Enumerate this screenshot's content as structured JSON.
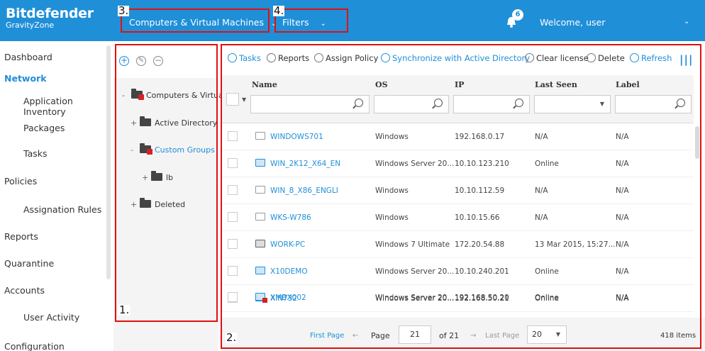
{
  "header": {
    "brand_name": "Bitdefender",
    "brand_sub": "GravityZone",
    "view_menu": "Computers & Virtual Machines",
    "filters_menu": "Filters",
    "notification_count": "6",
    "welcome": "Welcome, user"
  },
  "sidebar": {
    "items": [
      {
        "label": "Dashboard"
      },
      {
        "label": "Network"
      },
      {
        "label": "Application Inventory"
      },
      {
        "label": "Packages"
      },
      {
        "label": "Tasks"
      },
      {
        "label": "Policies"
      },
      {
        "label": "Assignation Rules"
      },
      {
        "label": "Reports"
      },
      {
        "label": "Quarantine"
      },
      {
        "label": "Accounts"
      },
      {
        "label": "User Activity"
      },
      {
        "label": "Configuration"
      }
    ]
  },
  "tree": {
    "nodes": [
      {
        "toggle": "-",
        "label": "Computers & Virtual"
      },
      {
        "toggle": "+",
        "label": "Active Directory"
      },
      {
        "toggle": "-",
        "label": "Custom Groups"
      },
      {
        "toggle": "+",
        "label": "lb"
      },
      {
        "toggle": "+",
        "label": "Deleted"
      }
    ]
  },
  "toolbar": {
    "tasks": "Tasks",
    "reports": "Reports",
    "assign_policy": "Assign Policy",
    "sync_ad": "Synchronize with Active Directory",
    "clear_license": "Clear license",
    "delete": "Delete",
    "refresh": "Refresh"
  },
  "grid": {
    "columns": [
      "Name",
      "OS",
      "IP",
      "Last Seen",
      "Label"
    ],
    "rows": [
      {
        "name": "WINDOWS701",
        "os": "Windows",
        "ip": "192.168.0.17",
        "last_seen": "N/A",
        "label": "N/A"
      },
      {
        "name": "WIN_2K12_X64_EN",
        "os": "Windows Server 20...",
        "ip": "10.10.123.210",
        "last_seen": "Online",
        "label": "N/A"
      },
      {
        "name": "WIN_8_X86_ENGLI",
        "os": "Windows",
        "ip": "10.10.112.59",
        "last_seen": "N/A",
        "label": "N/A"
      },
      {
        "name": "WKS-W786",
        "os": "Windows",
        "ip": "10.10.15.66",
        "last_seen": "N/A",
        "label": "N/A"
      },
      {
        "name": "WORK-PC",
        "os": "Windows 7 Ultimate",
        "ip": "172.20.54.88",
        "last_seen": "13 Mar 2015, 15:27...",
        "label": "N/A"
      },
      {
        "name": "X10DEMO",
        "os": "Windows Server 20...",
        "ip": "10.10.240.201",
        "last_seen": "Online",
        "label": "N/A"
      },
      {
        "name": "XIN732",
        "os": "Windows Server 20...",
        "ip": "192.168.50.21",
        "last_seen": "Online",
        "label": "N/A"
      },
      {
        "name": "XMBX002",
        "os": "Windows Server 20...",
        "ip": "192.168.50.20",
        "last_seen": "Online",
        "label": "N/A"
      }
    ]
  },
  "pager": {
    "first_page": "First Page",
    "prev_arrow": "←",
    "page_label": "Page",
    "current_page": "21",
    "of_label": "of 21",
    "next_arrow": "→",
    "last_page": "Last Page",
    "page_size": "20",
    "total_items": "418 items"
  },
  "callouts": [
    "1.",
    "2.",
    "3.",
    "4."
  ],
  "colors": {
    "brand_blue": "#1f8fd8",
    "callout_red": "#e01010",
    "alert_red": "#d42222"
  }
}
